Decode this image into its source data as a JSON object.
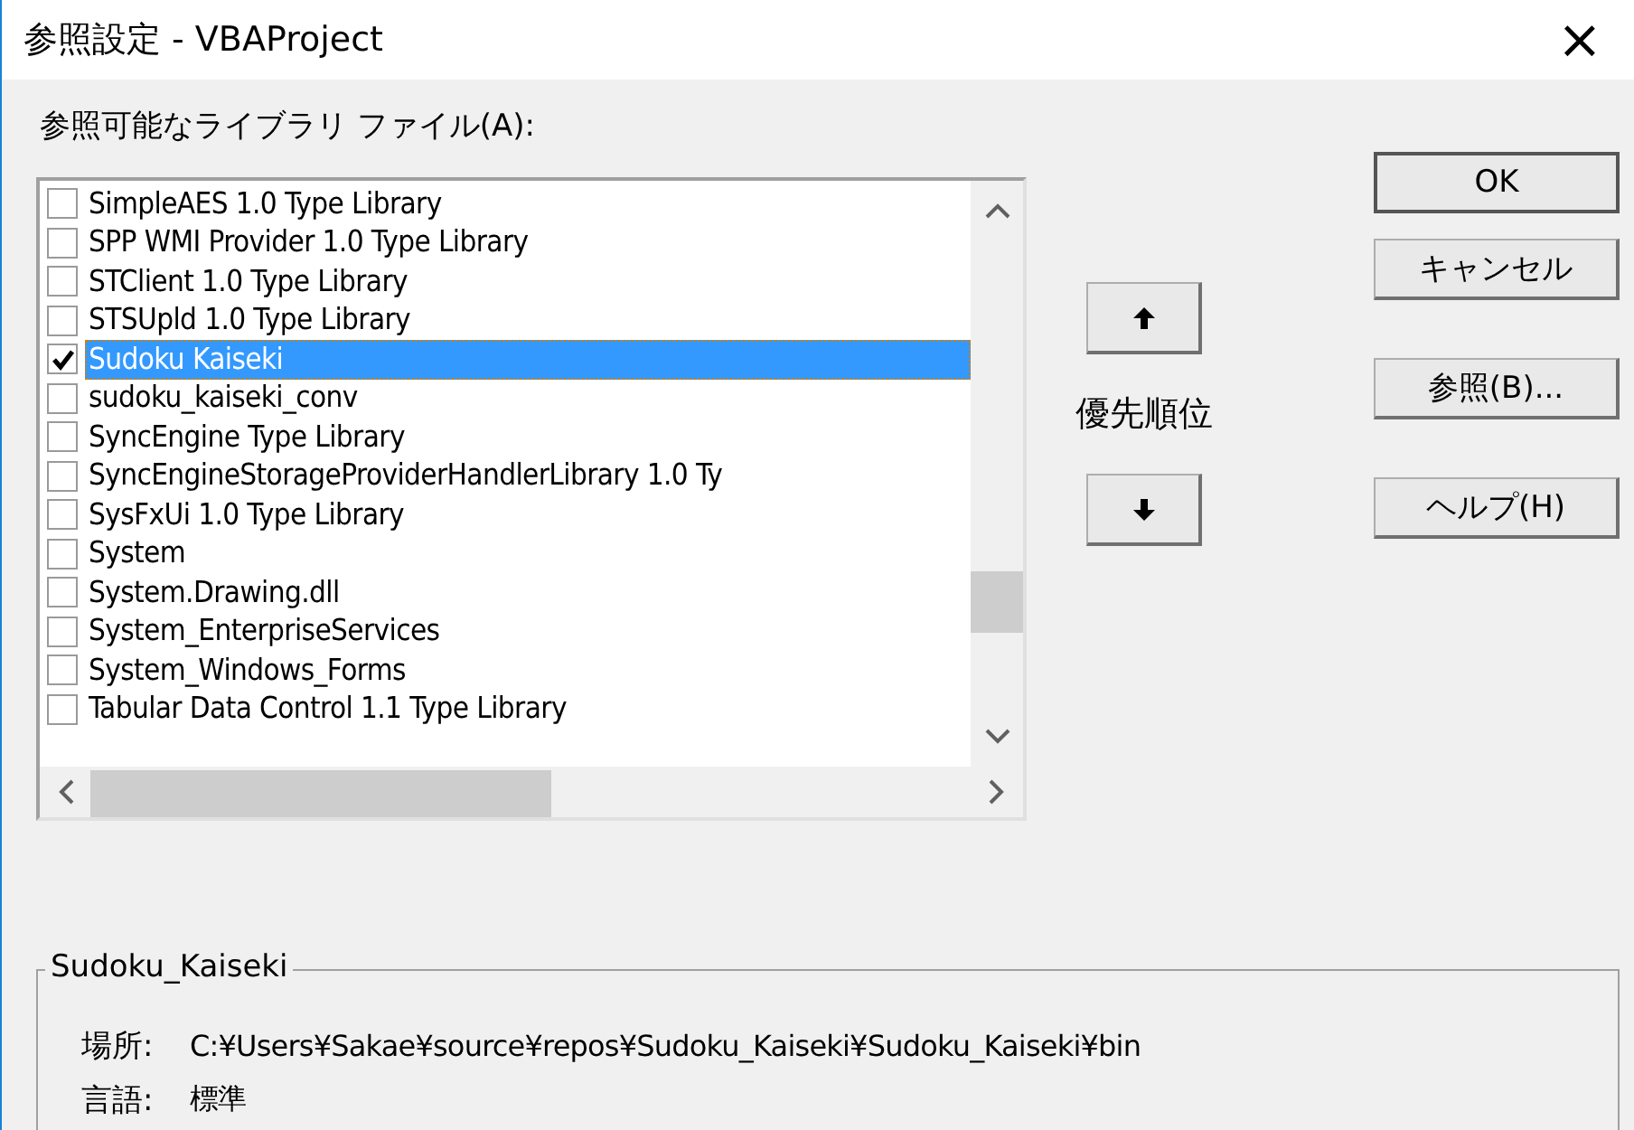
{
  "window": {
    "title": "参照設定 - VBAProject",
    "close": "×"
  },
  "list_label": "参照可能なライブラリ ファイル(A):",
  "libraries": [
    {
      "label": "SimpleAES 1.0 Type Library",
      "checked": false,
      "selected": false
    },
    {
      "label": "SPP WMI Provider 1.0 Type Library",
      "checked": false,
      "selected": false
    },
    {
      "label": "STClient 1.0 Type Library",
      "checked": false,
      "selected": false
    },
    {
      "label": "STSUpld 1.0 Type Library",
      "checked": false,
      "selected": false
    },
    {
      "label": "Sudoku Kaiseki",
      "checked": true,
      "selected": true
    },
    {
      "label": "sudoku_kaiseki_conv",
      "checked": false,
      "selected": false
    },
    {
      "label": "SyncEngine Type Library",
      "checked": false,
      "selected": false
    },
    {
      "label": "SyncEngineStorageProviderHandlerLibrary 1.0 Ty",
      "checked": false,
      "selected": false
    },
    {
      "label": "SysFxUi 1.0 Type Library",
      "checked": false,
      "selected": false
    },
    {
      "label": "System",
      "checked": false,
      "selected": false
    },
    {
      "label": "System.Drawing.dll",
      "checked": false,
      "selected": false
    },
    {
      "label": "System_EnterpriseServices",
      "checked": false,
      "selected": false
    },
    {
      "label": "System_Windows_Forms",
      "checked": false,
      "selected": false
    },
    {
      "label": "Tabular Data Control 1.1 Type Library",
      "checked": false,
      "selected": false
    }
  ],
  "priority_label": "優先順位",
  "buttons": [
    "OK",
    "キャンセル",
    "参照(B)...",
    "ヘルプ(H)"
  ],
  "details": {
    "title": "Sudoku_Kaiseki",
    "fields": [
      {
        "label": "場所:",
        "value": "C:¥Users¥Sakae¥source¥repos¥Sudoku_Kaiseki¥Sudoku_Kaiseki¥bin"
      },
      {
        "label": "言語:",
        "value": "標準"
      }
    ]
  }
}
